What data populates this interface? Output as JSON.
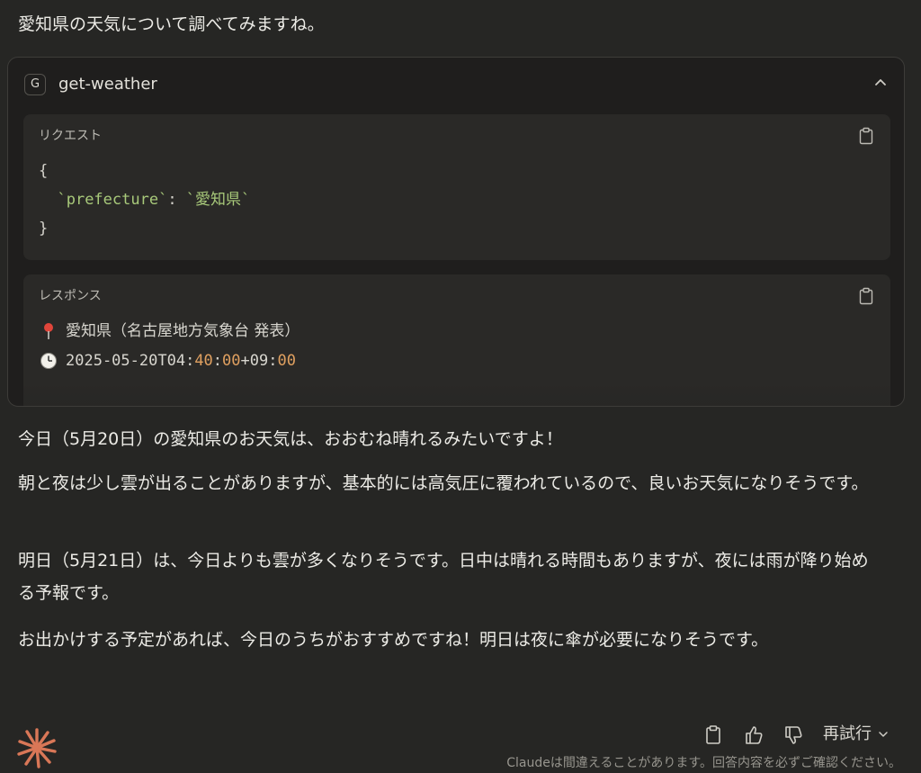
{
  "intro": "愛知県の天気について調べてみますね。",
  "tool": {
    "badge": "G",
    "name": "get-weather",
    "request": {
      "label": "リクエスト",
      "open": "{",
      "key": "`prefecture`",
      "colon": ": ",
      "value": "`愛知県`",
      "close": "}"
    },
    "response": {
      "label": "レスポンス",
      "location": "愛知県（名古屋地方気象台 発表）",
      "time_prefix": "2025-05-20T04",
      "time_sep1": ":",
      "time_min": "40",
      "time_sep2": ":",
      "time_sec": "00",
      "time_plus": "+09",
      "time_sep3": ":",
      "time_tz": "00"
    }
  },
  "paragraphs": [
    "今日（5月20日）の愛知県のお天気は、おおむね晴れるみたいですよ！",
    "朝と夜は少し雲が出ることがありますが、基本的には高気圧に覆われているので、良いお天気になりそうです。",
    "明日（5月21日）は、今日よりも雲が多くなりそうです。日中は晴れる時間もありますが、夜には雨が降り始める予報です。",
    "お出かけする予定があれば、今日のうちがおすすめですね！明日は夜に傘が必要になりそうです。"
  ],
  "footer": {
    "retry_label": "再試行",
    "disclaimer": "Claudeは間違えることがあります。回答内容を必ずご確認ください。"
  },
  "colors": {
    "background": "#262624",
    "accent": "#d97757",
    "code_string": "#a8c97a",
    "code_number": "#e0a060"
  }
}
